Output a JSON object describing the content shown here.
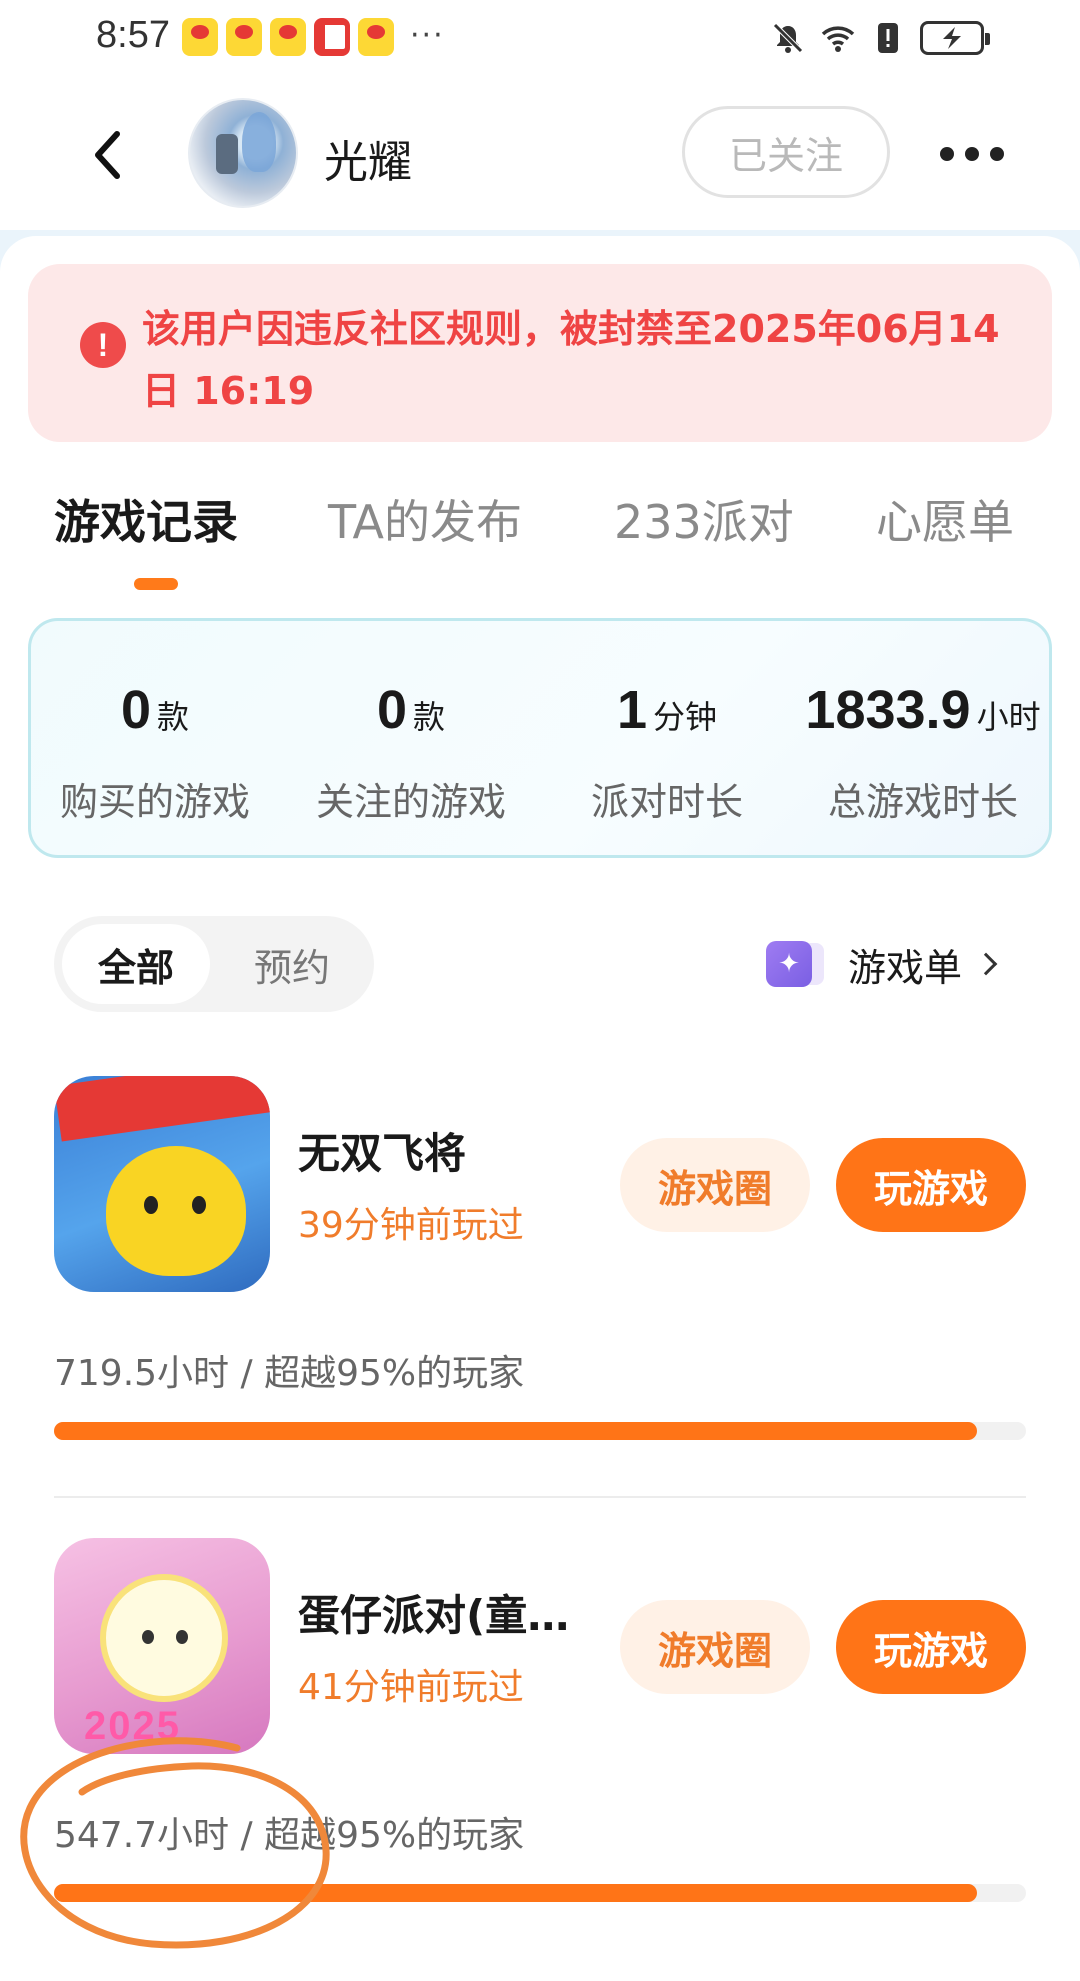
{
  "status_bar": {
    "time": "8:57",
    "more": "···",
    "notification_icons": [
      "weibo-icon",
      "weibo-icon",
      "weibo-icon",
      "book-icon",
      "weibo-icon"
    ],
    "right_icons": [
      "mute-icon",
      "wifi-icon",
      "alert-icon",
      "battery-charging-icon"
    ]
  },
  "header": {
    "username": "光耀",
    "follow_label": "已关注"
  },
  "ban_notice": {
    "text": "该用户因违反社区规则，被封禁至2025年06月14日 16:19"
  },
  "tabs": [
    {
      "label": "游戏记录",
      "active": true
    },
    {
      "label": "TA的发布",
      "active": false
    },
    {
      "label": "233派对",
      "active": false
    },
    {
      "label": "心愿单",
      "active": false
    }
  ],
  "stats": [
    {
      "value": "0",
      "unit": "款",
      "label": "购买的游戏"
    },
    {
      "value": "0",
      "unit": "款",
      "label": "关注的游戏"
    },
    {
      "value": "1",
      "unit": "分钟",
      "label": "派对时长"
    },
    {
      "value": "1833.9",
      "unit": "小时",
      "label": "总游戏时长"
    }
  ],
  "filter": {
    "all_label": "全部",
    "reserve_label": "预约",
    "gamelist_label": "游戏单"
  },
  "games": [
    {
      "name": "无双飞将",
      "last_played": "39分钟前玩过",
      "stat_text": "719.5小时 / 超越95%的玩家",
      "progress": 0.95,
      "circle_label": "游戏圈",
      "play_label": "玩游戏"
    },
    {
      "name": "蛋仔派对(童…",
      "last_played": "41分钟前玩过",
      "stat_text": "547.7小时 / 超越95%的玩家",
      "progress": 0.95,
      "circle_label": "游戏圈",
      "play_label": "玩游戏"
    }
  ],
  "colors": {
    "accent": "#ff7417",
    "ban_text": "#ef4444",
    "ban_bg": "#fde8e8",
    "annotation": "#f0883a"
  }
}
